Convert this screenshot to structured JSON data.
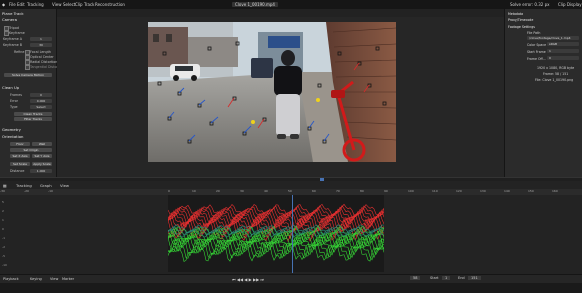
{
  "topbar": {
    "menus": [
      "File",
      "Edit",
      "Render",
      "Window",
      "Help"
    ],
    "workspace_tabs": [
      "Tracking",
      "Masking",
      "Motion"
    ],
    "clip_menus": [
      "View",
      "Select",
      "Clip",
      "Track",
      "Reconstruction"
    ],
    "clip_name": "Clove 1_00190.mp4",
    "right_info": "Solve error: 0.32 px",
    "display_label": "Clip Display"
  },
  "leftpanel": {
    "sections": {
      "plane_track": "Plane Track",
      "camera": "Camera",
      "clean_up": "Clean Up",
      "geometry": "Geometry",
      "orientation": "Orientation"
    },
    "solve": {
      "tripod": "Tripod",
      "keyframe": "Keyframe",
      "keyframe_a_label": "Keyframe A",
      "keyframe_a": "1",
      "keyframe_b_label": "Keyframe B",
      "keyframe_b": "30",
      "refine_label": "Refine",
      "refine_opts": [
        "Focal Length",
        "Optical Center",
        "Radial Distortion",
        "Tangential Distortion"
      ],
      "solve_button": "Solve Camera Motion"
    },
    "cleanup": {
      "frames_label": "Frames",
      "frames": "0",
      "error_label": "Error",
      "error": "0.000",
      "type_label": "Type",
      "type": "Select",
      "clean_tracks": "Clean Tracks",
      "filter_tracks": "Filter Tracks"
    },
    "orientation": {
      "floor": "Floor",
      "wall": "Wall",
      "set_origin": "Set Origin",
      "set_x_axis": "Set X Axis",
      "set_y_axis": "Set Y Axis",
      "set_scale": "Set Scale",
      "apply_scale": "Apply Scale",
      "distance_label": "Distance",
      "distance": "1.000"
    }
  },
  "rightpanel": {
    "sections": {
      "metadata": "Metadata",
      "proxy": "Proxy/Timecode",
      "footage": "Footage Settings"
    },
    "file_path_label": "File Path",
    "file_path": "/clove/footage/clove_1.mp4",
    "color_space_label": "Color Space",
    "color_space": "sRGB",
    "start_frame_label": "Start Frame",
    "start_frame": "1",
    "frame_offset_label": "Frame Off...",
    "frame_offset": "0",
    "resolution": "1920 x 1080, RGB byte",
    "frame_info": "Frame: 58 / 151",
    "file_info": "File: Clove 1_00190.png"
  },
  "timeline": {
    "frames": [
      "-30",
      "-20",
      "-10",
      "0",
      "10",
      "20",
      "30",
      "40",
      "50",
      "60",
      "70",
      "80",
      "90",
      "100",
      "110",
      "120",
      "130",
      "140",
      "150",
      "160",
      "170",
      "180",
      "190",
      "200",
      "210"
    ]
  },
  "graph": {
    "header_items": [
      "Tracking",
      "Graph",
      "View"
    ],
    "y_labels": [
      "5",
      "2",
      "1",
      "0",
      "-1",
      "-2",
      "-5",
      "-10"
    ],
    "colors": {
      "x_curve": "#e63030",
      "y_curve": "#35d335",
      "mid": "#2a8f7a"
    }
  },
  "playback": {
    "items": [
      "Playback",
      "Keying",
      "View",
      "Marker"
    ],
    "current_frame": "58",
    "start_label": "Start",
    "start": "1",
    "end_label": "End",
    "end": "151"
  },
  "footage_colors": {
    "sky": "#c9d4db",
    "road": "#8c8a86",
    "brick": "#7a4a3a",
    "bike": "#d21a1a"
  }
}
